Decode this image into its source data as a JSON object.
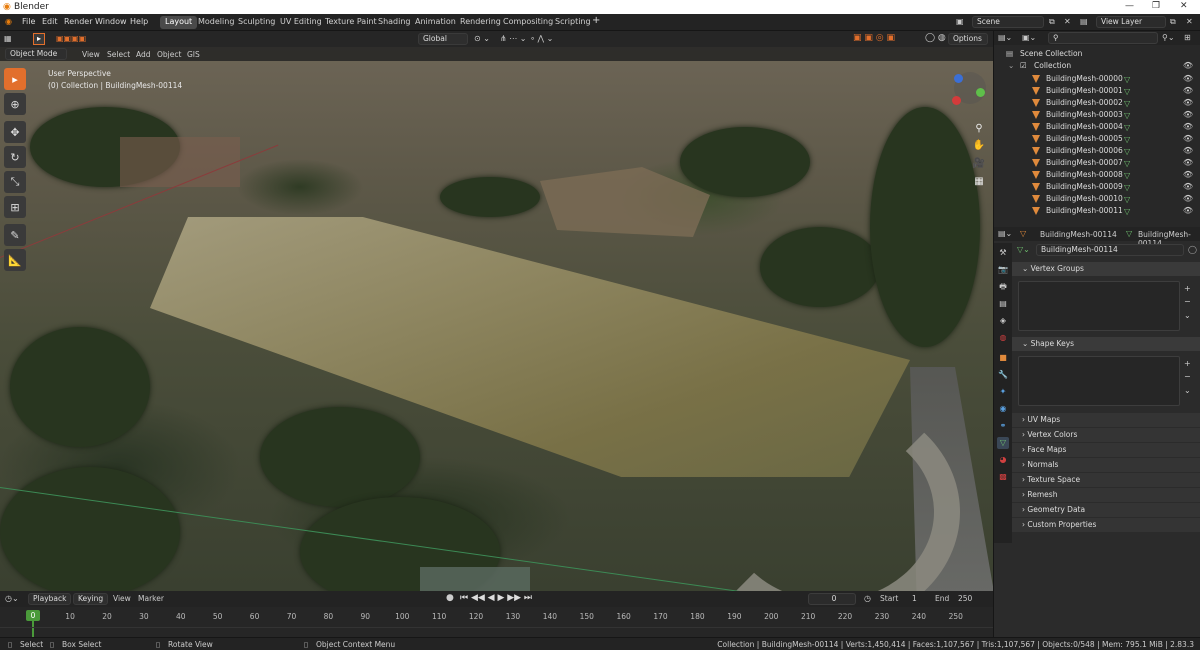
{
  "title_bar": {
    "app_title": "Blender"
  },
  "menu": [
    "File",
    "Edit",
    "Render",
    "Window",
    "Help"
  ],
  "workspaces": [
    "Layout",
    "Modeling",
    "Sculpting",
    "UV Editing",
    "Texture Paint",
    "Shading",
    "Animation",
    "Rendering",
    "Compositing",
    "Scripting"
  ],
  "scene_field": "Scene",
  "view_layer_field": "View Layer",
  "viewport_header": {
    "mode": "Object Mode",
    "view": "View",
    "select": "Select",
    "add": "Add",
    "object": "Object",
    "gis": "GIS",
    "transform": "Global",
    "options": "Options"
  },
  "viewport": {
    "perspective": "User Perspective",
    "collection_label": "(0) Collection | BuildingMesh-00114"
  },
  "outliner": {
    "root": "Scene Collection",
    "collection": "Collection",
    "items": [
      "BuildingMesh-00000",
      "BuildingMesh-00001",
      "BuildingMesh-00002",
      "BuildingMesh-00003",
      "BuildingMesh-00004",
      "BuildingMesh-00005",
      "BuildingMesh-00006",
      "BuildingMesh-00007",
      "BuildingMesh-00008",
      "BuildingMesh-00009",
      "BuildingMesh-00010",
      "BuildingMesh-00011"
    ]
  },
  "properties": {
    "object_name": "BuildingMesh-00114",
    "data_name": "BuildingMesh-00114",
    "mesh_field": "BuildingMesh-00114",
    "sections_open": [
      "Vertex Groups",
      "Shape Keys"
    ],
    "sections_closed": [
      "UV Maps",
      "Vertex Colors",
      "Face Maps",
      "Normals",
      "Texture Space",
      "Remesh",
      "Geometry Data",
      "Custom Properties"
    ]
  },
  "timeline": {
    "playback": "Playback",
    "keying": "Keying",
    "view": "View",
    "marker": "Marker",
    "current_frame": "0",
    "start_label": "Start",
    "start": "1",
    "end_label": "End",
    "end": "250",
    "ticks": [
      "0",
      "10",
      "20",
      "30",
      "40",
      "50",
      "60",
      "70",
      "80",
      "90",
      "100",
      "110",
      "120",
      "130",
      "140",
      "150",
      "160",
      "170",
      "180",
      "190",
      "200",
      "210",
      "220",
      "230",
      "240",
      "250"
    ]
  },
  "status": {
    "select": "Select",
    "box_select": "Box Select",
    "rotate_view": "Rotate View",
    "context_menu": "Object Context Menu",
    "stats": "Collection | BuildingMesh-00114 | Verts:1,450,414 | Faces:1,107,567 | Tris:1,107,567 | Objects:0/548 | Mem: 795.1 MiB | 2.83.3"
  },
  "colors": {
    "accent": "#e26f2c",
    "selection": "#3a4756"
  }
}
